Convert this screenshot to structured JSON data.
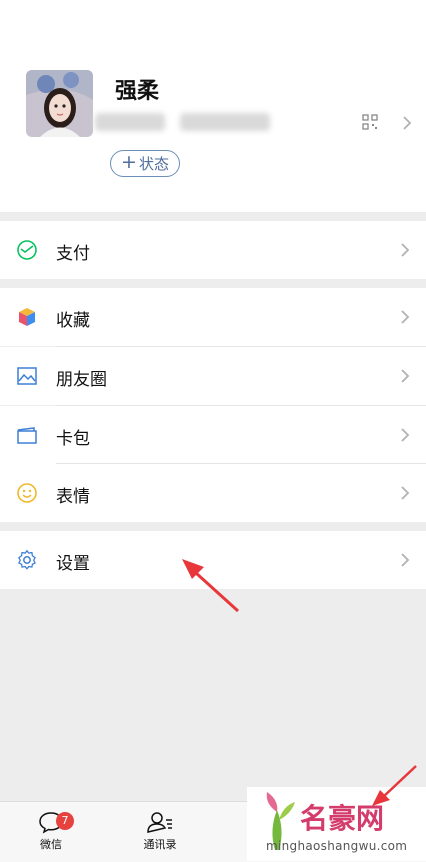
{
  "profile": {
    "name": "强柔",
    "status_label": "状态",
    "status_plus": "+"
  },
  "menu": {
    "pay": "支付",
    "favorites": "收藏",
    "moments": "朋友圈",
    "cards": "卡包",
    "stickers": "表情",
    "settings": "设置"
  },
  "tabs": {
    "chats": "微信",
    "contacts": "通讯录",
    "chats_badge": "7"
  },
  "watermark": {
    "title": "名豪网",
    "url": "minghaoshangwu.com"
  },
  "colors": {
    "accent_green": "#07c160",
    "link_blue": "#4e6e9c",
    "badge_red": "#e64340",
    "arrow_red": "#e8373a"
  }
}
